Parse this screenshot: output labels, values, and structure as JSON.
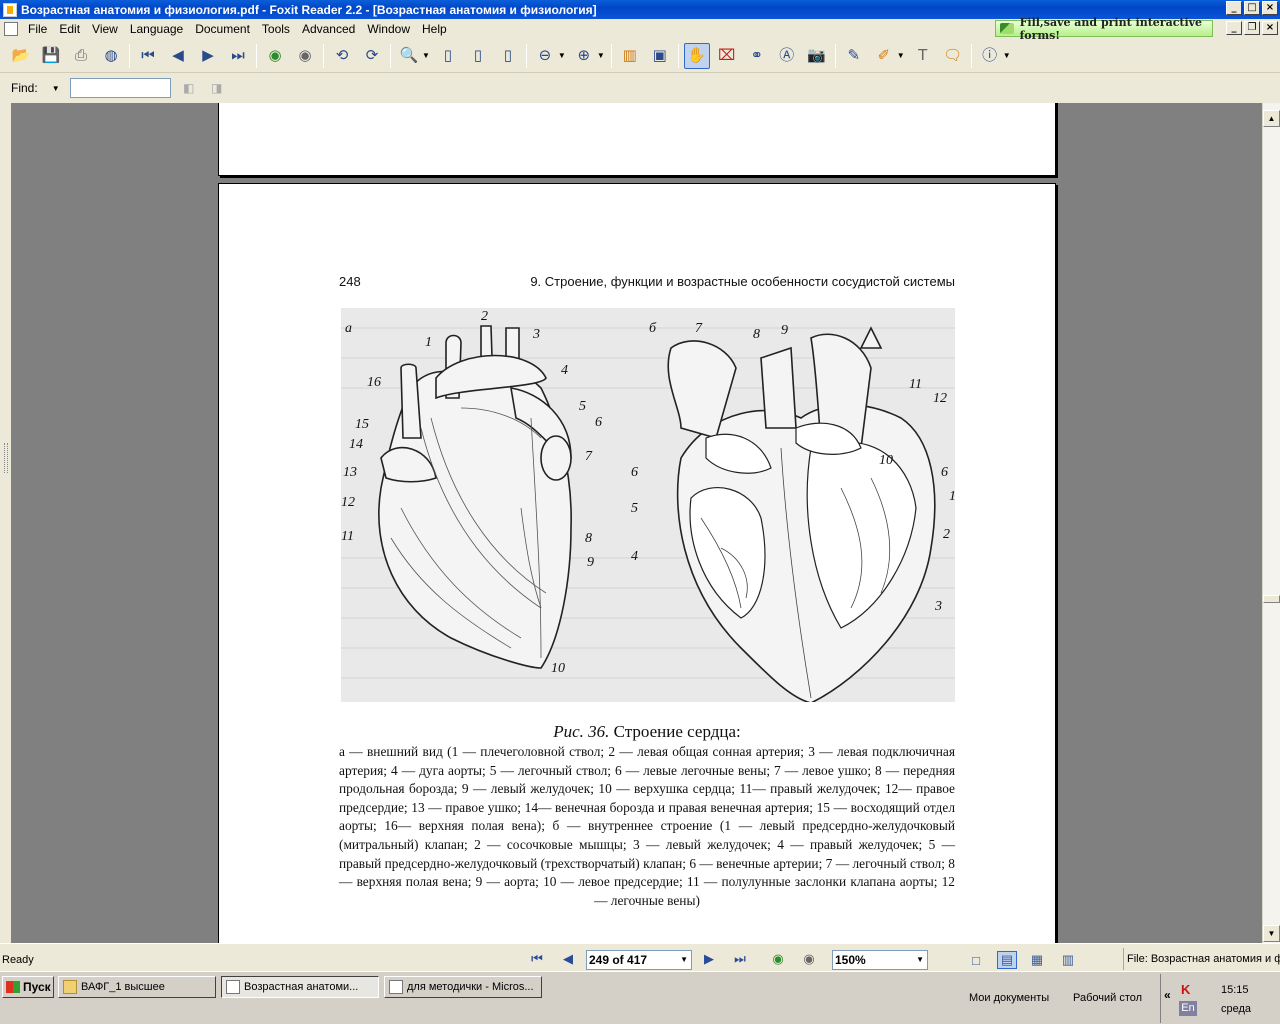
{
  "window": {
    "title": "Возрастная анатомия и физиология.pdf - Foxit Reader 2.2 - [Возрастная анатомия и физиология]"
  },
  "menu": [
    "File",
    "Edit",
    "View",
    "Language",
    "Document",
    "Tools",
    "Advanced",
    "Window",
    "Help"
  ],
  "banner": {
    "text": "Fill,save and print interactive forms!"
  },
  "find": {
    "label": "Find:",
    "value": ""
  },
  "page": {
    "number": "248",
    "running_head": "9. Строение, функции и возрастные особенности сосудистой системы",
    "figure": {
      "panel_a": "а",
      "panel_b": "б",
      "labels_a": [
        "1",
        "2",
        "3",
        "4",
        "5",
        "6",
        "7",
        "8",
        "9",
        "10",
        "11",
        "12",
        "13",
        "14",
        "15",
        "16"
      ],
      "labels_b": [
        "1",
        "2",
        "3",
        "4",
        "5",
        "6",
        "6",
        "7",
        "8",
        "9",
        "10",
        "11",
        "12"
      ]
    },
    "caption_number": "Рис. 36.",
    "caption_title": "Строение сердца:",
    "caption_body": "а — внешний вид (1 — плечеголовной ствол; 2 — левая общая сонная артерия; 3 — левая подключичная артерия; 4 — дуга аорты; 5 — легочный ствол; 6 — левые легочные вены; 7 — левое ушко; 8 — передняя продольная борозда; 9 — левый желудочек; 10 — верхушка сердца; 11— правый желудочек; 12— правое предсердие; 13 — правое ушко; 14— венечная борозда и правая венечная артерия; 15 — восходящий отдел аорты; 16— верхняя полая вена); б — внутреннее строение (1 — левый предсердно-желудочковый (митральный) клапан; 2 — сосочковые мышцы; 3 — левый желудочек; 4 — правый желудочек; 5 — правый предсердно-желудочковый (трехстворчатый) клапан; 6 — венечные артерии; 7 — легочный ствол; 8 — верхняя полая вена; 9 — аорта; 10 — левое предсердие; 11 — полулунные заслонки клапана аорты; 12 — легочные вены)"
  },
  "statusbar": {
    "status": "Ready",
    "page_indicator": "249 of 417",
    "zoom": "150%",
    "file_info": "File: Возрастная анатомия и физиология.pdf"
  },
  "taskbar": {
    "start": "Пуск",
    "tasks": [
      "ВАФГ_1 высшее",
      "Возрастная анатоми...",
      "для методички - Micros..."
    ],
    "quick_links": [
      "Мои документы",
      "Рабочий стол"
    ],
    "tray_lang": "En",
    "time": "15:15",
    "day": "среда"
  },
  "colors": {
    "titlebar": "#0a5fd8",
    "chrome": "#ece9d8",
    "workspace": "#808080"
  }
}
